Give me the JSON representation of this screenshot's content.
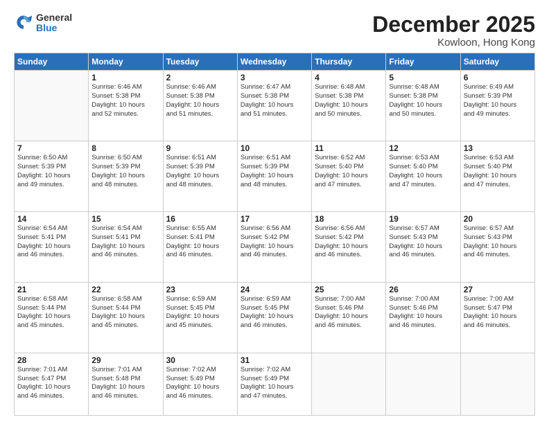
{
  "logo": {
    "general": "General",
    "blue": "Blue"
  },
  "header": {
    "month": "December 2025",
    "location": "Kowloon, Hong Kong"
  },
  "weekdays": [
    "Sunday",
    "Monday",
    "Tuesday",
    "Wednesday",
    "Thursday",
    "Friday",
    "Saturday"
  ],
  "weeks": [
    [
      {
        "day": "",
        "text": ""
      },
      {
        "day": "1",
        "text": "Sunrise: 6:46 AM\nSunset: 5:38 PM\nDaylight: 10 hours\nand 52 minutes."
      },
      {
        "day": "2",
        "text": "Sunrise: 6:46 AM\nSunset: 5:38 PM\nDaylight: 10 hours\nand 51 minutes."
      },
      {
        "day": "3",
        "text": "Sunrise: 6:47 AM\nSunset: 5:38 PM\nDaylight: 10 hours\nand 51 minutes."
      },
      {
        "day": "4",
        "text": "Sunrise: 6:48 AM\nSunset: 5:38 PM\nDaylight: 10 hours\nand 50 minutes."
      },
      {
        "day": "5",
        "text": "Sunrise: 6:48 AM\nSunset: 5:38 PM\nDaylight: 10 hours\nand 50 minutes."
      },
      {
        "day": "6",
        "text": "Sunrise: 6:49 AM\nSunset: 5:39 PM\nDaylight: 10 hours\nand 49 minutes."
      }
    ],
    [
      {
        "day": "7",
        "text": "Sunrise: 6:50 AM\nSunset: 5:39 PM\nDaylight: 10 hours\nand 49 minutes."
      },
      {
        "day": "8",
        "text": "Sunrise: 6:50 AM\nSunset: 5:39 PM\nDaylight: 10 hours\nand 48 minutes."
      },
      {
        "day": "9",
        "text": "Sunrise: 6:51 AM\nSunset: 5:39 PM\nDaylight: 10 hours\nand 48 minutes."
      },
      {
        "day": "10",
        "text": "Sunrise: 6:51 AM\nSunset: 5:39 PM\nDaylight: 10 hours\nand 48 minutes."
      },
      {
        "day": "11",
        "text": "Sunrise: 6:52 AM\nSunset: 5:40 PM\nDaylight: 10 hours\nand 47 minutes."
      },
      {
        "day": "12",
        "text": "Sunrise: 6:53 AM\nSunset: 5:40 PM\nDaylight: 10 hours\nand 47 minutes."
      },
      {
        "day": "13",
        "text": "Sunrise: 6:53 AM\nSunset: 5:40 PM\nDaylight: 10 hours\nand 47 minutes."
      }
    ],
    [
      {
        "day": "14",
        "text": "Sunrise: 6:54 AM\nSunset: 5:41 PM\nDaylight: 10 hours\nand 46 minutes."
      },
      {
        "day": "15",
        "text": "Sunrise: 6:54 AM\nSunset: 5:41 PM\nDaylight: 10 hours\nand 46 minutes."
      },
      {
        "day": "16",
        "text": "Sunrise: 6:55 AM\nSunset: 5:41 PM\nDaylight: 10 hours\nand 46 minutes."
      },
      {
        "day": "17",
        "text": "Sunrise: 6:56 AM\nSunset: 5:42 PM\nDaylight: 10 hours\nand 46 minutes."
      },
      {
        "day": "18",
        "text": "Sunrise: 6:56 AM\nSunset: 5:42 PM\nDaylight: 10 hours\nand 46 minutes."
      },
      {
        "day": "19",
        "text": "Sunrise: 6:57 AM\nSunset: 5:43 PM\nDaylight: 10 hours\nand 46 minutes."
      },
      {
        "day": "20",
        "text": "Sunrise: 6:57 AM\nSunset: 5:43 PM\nDaylight: 10 hours\nand 46 minutes."
      }
    ],
    [
      {
        "day": "21",
        "text": "Sunrise: 6:58 AM\nSunset: 5:44 PM\nDaylight: 10 hours\nand 45 minutes."
      },
      {
        "day": "22",
        "text": "Sunrise: 6:58 AM\nSunset: 5:44 PM\nDaylight: 10 hours\nand 45 minutes."
      },
      {
        "day": "23",
        "text": "Sunrise: 6:59 AM\nSunset: 5:45 PM\nDaylight: 10 hours\nand 45 minutes."
      },
      {
        "day": "24",
        "text": "Sunrise: 6:59 AM\nSunset: 5:45 PM\nDaylight: 10 hours\nand 46 minutes."
      },
      {
        "day": "25",
        "text": "Sunrise: 7:00 AM\nSunset: 5:46 PM\nDaylight: 10 hours\nand 46 minutes."
      },
      {
        "day": "26",
        "text": "Sunrise: 7:00 AM\nSunset: 5:46 PM\nDaylight: 10 hours\nand 46 minutes."
      },
      {
        "day": "27",
        "text": "Sunrise: 7:00 AM\nSunset: 5:47 PM\nDaylight: 10 hours\nand 46 minutes."
      }
    ],
    [
      {
        "day": "28",
        "text": "Sunrise: 7:01 AM\nSunset: 5:47 PM\nDaylight: 10 hours\nand 46 minutes."
      },
      {
        "day": "29",
        "text": "Sunrise: 7:01 AM\nSunset: 5:48 PM\nDaylight: 10 hours\nand 46 minutes."
      },
      {
        "day": "30",
        "text": "Sunrise: 7:02 AM\nSunset: 5:49 PM\nDaylight: 10 hours\nand 46 minutes."
      },
      {
        "day": "31",
        "text": "Sunrise: 7:02 AM\nSunset: 5:49 PM\nDaylight: 10 hours\nand 47 minutes."
      },
      {
        "day": "",
        "text": ""
      },
      {
        "day": "",
        "text": ""
      },
      {
        "day": "",
        "text": ""
      }
    ]
  ]
}
